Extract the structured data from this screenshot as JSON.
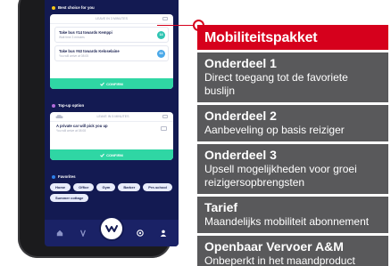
{
  "app": {
    "best_choice": {
      "title": "Best choice for you",
      "card_header": "LEAVE IN 3 MINUTES",
      "trips": [
        {
          "title": "Take bus #14 towards Kemppi",
          "sub": "Wait time 3 minutes",
          "badge": "14"
        },
        {
          "title": "Take bus #63 towards Keloselaine",
          "sub": "You will arrive at 08:05",
          "badge": "63"
        }
      ],
      "confirm": "CONFIRM"
    },
    "top_up": {
      "title": "Top-up option",
      "card_header": "LEAVE IN 5 MINUTES",
      "car_label": "A private car will pick you up",
      "car_sub": "You will arrive at 08:08",
      "confirm": "CONFIRM"
    },
    "favorites": {
      "title": "Favorites",
      "chips": [
        "Home",
        "Office",
        "Gym",
        "Barber",
        "Pre-school",
        "Summer cottage"
      ]
    },
    "tabbar": {
      "icons": [
        "home-icon",
        "explore-icon",
        "whim-logo-icon",
        "network-icon",
        "profile-icon"
      ]
    }
  },
  "panel": {
    "title": "Mobiliteitspakket",
    "blocks": [
      {
        "heading": "Onderdeel 1",
        "desc": "Direct toegang tot de favoriete buslijn"
      },
      {
        "heading": "Onderdeel 2",
        "desc": "Aanbeveling op basis reiziger"
      },
      {
        "heading": "Onderdeel 3",
        "desc": "Upsell mogelijkheden voor groei reizigersopbrengsten"
      },
      {
        "heading": "Tarief",
        "desc": "Maandelijks mobiliteit abonnement"
      },
      {
        "heading": "Openbaar Vervoer A&M",
        "desc": "Onbeperkt in het maandproduct"
      }
    ]
  },
  "colors": {
    "brand_red": "#d6001c",
    "panel_grey": "#59595b",
    "app_navy": "#131a52",
    "confirm_green": "#2fd6a4"
  }
}
